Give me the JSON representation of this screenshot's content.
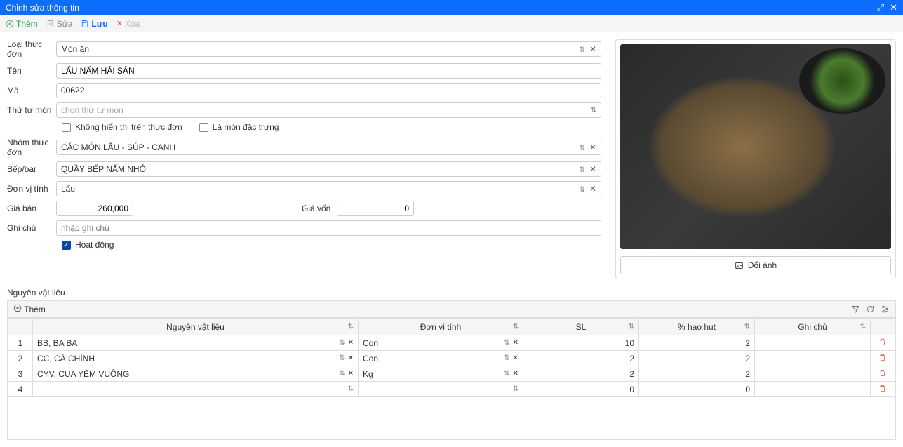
{
  "window": {
    "title": "Chỉnh sửa thông tin"
  },
  "toolbar": {
    "add": "Thêm",
    "edit": "Sửa",
    "save": "Lưu",
    "delete": "Xóa"
  },
  "form": {
    "menu_type_label": "Loại thực đơn",
    "menu_type_value": "Món ăn",
    "name_label": "Tên",
    "name_value": "LẨU NẤM HẢI SẢN",
    "code_label": "Mã",
    "code_value": "00622",
    "order_label": "Thứ tự món",
    "order_placeholder": "chọn thứ tự món",
    "hide_label": "Không hiển thị trên thực đơn",
    "special_label": "Là món đặc trưng",
    "group_label": "Nhóm thực đơn",
    "group_value": "CÁC MÓN LẨU - SÚP - CANH",
    "kitchen_label": "Bếp/bar",
    "kitchen_value": "QUẦY BẾP NẤM NHỎ",
    "unit_label": "Đơn vị tính",
    "unit_value": "Lẩu",
    "price_label": "Giá bán",
    "price_value": "260,000",
    "cost_label": "Giá vốn",
    "cost_value": "0",
    "note_label": "Ghi chú",
    "note_placeholder": "nhập ghi chú",
    "active_label": "Hoạt động"
  },
  "image": {
    "change_btn": "Đổi ảnh"
  },
  "ingredients": {
    "section_label": "Nguyên vật liệu",
    "add_btn": "Thêm",
    "columns": {
      "name": "Nguyên vật liệu",
      "unit": "Đơn vị tính",
      "qty": "SL",
      "loss": "% hao hụt",
      "note": "Ghi chú"
    },
    "rows": [
      {
        "idx": "1",
        "name": "BB, BA BA",
        "unit": "Con",
        "qty": "10",
        "loss": "2",
        "note": ""
      },
      {
        "idx": "2",
        "name": "CC, CÁ CHÌNH",
        "unit": "Con",
        "qty": "2",
        "loss": "2",
        "note": ""
      },
      {
        "idx": "3",
        "name": "CYV, CUA YẾM VUÔNG",
        "unit": "Kg",
        "qty": "2",
        "loss": "2",
        "note": ""
      },
      {
        "idx": "4",
        "name": "",
        "unit": "",
        "qty": "0",
        "loss": "0",
        "note": ""
      }
    ]
  }
}
